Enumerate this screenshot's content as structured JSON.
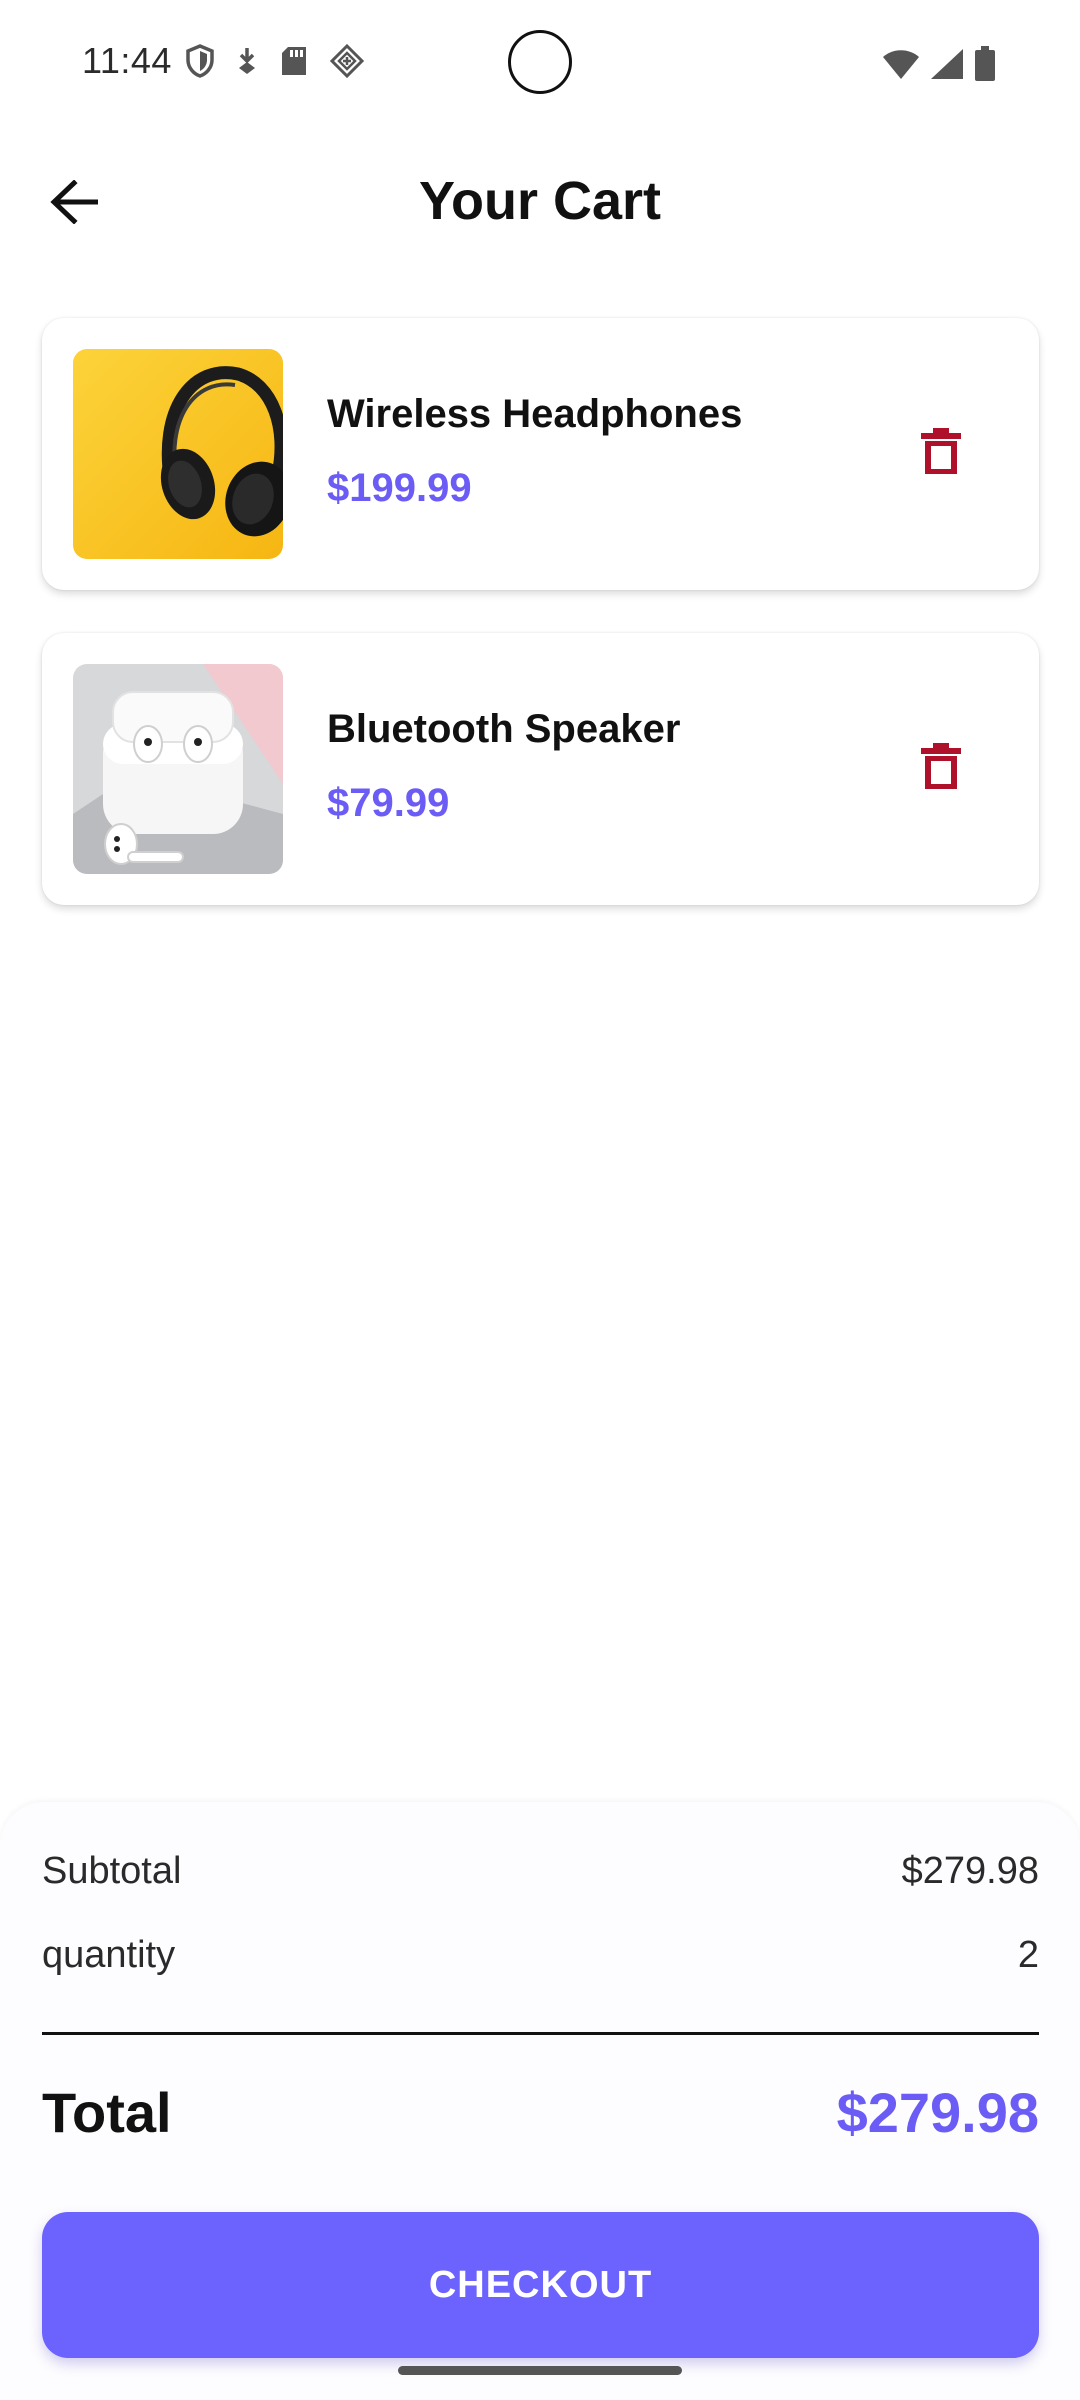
{
  "status_bar": {
    "time": "11:44",
    "icons_left": [
      "shield-icon",
      "download-icon",
      "sd-card-icon",
      "diamond-app-icon"
    ],
    "icons_right": [
      "wifi-icon",
      "signal-icon",
      "battery-icon"
    ]
  },
  "app_bar": {
    "title": "Your Cart",
    "back_icon": "arrow-left-icon"
  },
  "cart": {
    "items": [
      {
        "name": "Wireless Headphones",
        "price": "$199.99",
        "image": "headphones-on-yellow",
        "delete_icon": "trash-icon"
      },
      {
        "name": "Bluetooth Speaker",
        "price": "$79.99",
        "image": "white-earbuds-case",
        "delete_icon": "trash-icon"
      }
    ]
  },
  "summary": {
    "subtotal_label": "Subtotal",
    "subtotal_value": "$279.98",
    "quantity_label": "quantity",
    "quantity_value": "2",
    "total_label": "Total",
    "total_value": "$279.98"
  },
  "checkout": {
    "label": "CHECKOUT"
  },
  "colors": {
    "accent": "#6c63ff",
    "price": "#6a5cf5",
    "delete": "#b0112a"
  }
}
